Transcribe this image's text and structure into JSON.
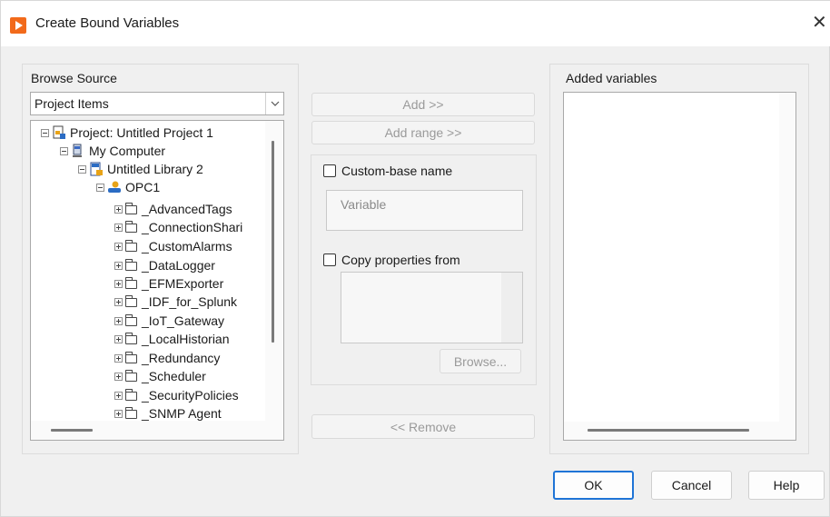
{
  "window": {
    "title": "Create Bound Variables",
    "close_glyph": "✕"
  },
  "browse": {
    "label": "Browse Source",
    "source_value": "Project Items",
    "tree": {
      "project": "Project: Untitled Project 1",
      "computer": "My Computer",
      "library": "Untitled Library 2",
      "server": "OPC1",
      "folders": [
        "_AdvancedTags",
        "_ConnectionShari",
        "_CustomAlarms",
        "_DataLogger",
        "_EFMExporter",
        "_IDF_for_Splunk",
        "_IoT_Gateway",
        "_LocalHistorian",
        "_Redundancy",
        "_Scheduler",
        "_SecurityPolicies",
        "_SNMP Agent"
      ]
    }
  },
  "middle": {
    "add": "Add >>",
    "add_range": "Add range >>",
    "custom_base_name": {
      "label": "Custom-base name",
      "checked": false,
      "placeholder": "Variable"
    },
    "copy_properties": {
      "label": "Copy properties from",
      "checked": false
    },
    "browse_button": "Browse...",
    "remove": "<< Remove"
  },
  "added": {
    "label": "Added variables"
  },
  "footer": {
    "ok": "OK",
    "cancel": "Cancel",
    "help": "Help"
  },
  "colors": {
    "accent": "#1f74d6",
    "app_icon": "#f26a1b"
  }
}
